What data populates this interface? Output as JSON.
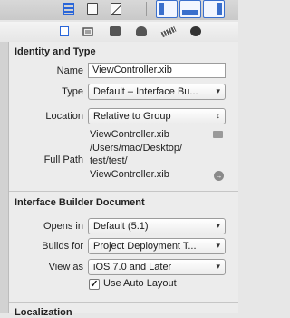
{
  "identity_and_type": {
    "title": "Identity and Type",
    "name_label": "Name",
    "name_value": "ViewController.xib",
    "type_label": "Type",
    "type_value": "Default – Interface Bu...",
    "location_label": "Location",
    "location_value": "Relative to Group",
    "location_file": "ViewController.xib",
    "full_path_label": "Full Path",
    "full_path_line1": "/Users/mac/Desktop/",
    "full_path_line2": "test/test/",
    "full_path_line3": "ViewController.xib"
  },
  "interface_builder_document": {
    "title": "Interface Builder Document",
    "opens_in_label": "Opens in",
    "opens_in_value": "Default (5.1)",
    "builds_for_label": "Builds for",
    "builds_for_value": "Project Deployment T...",
    "view_as_label": "View as",
    "view_as_value": "iOS 7.0 and Later",
    "auto_layout_label": "Use Auto Layout",
    "auto_layout_checked": true
  },
  "next_section": {
    "title": "Localization"
  },
  "icons": {
    "popup_arrow": "▾",
    "stepper_arrow": "↕",
    "reveal": "→",
    "check": "✓"
  }
}
